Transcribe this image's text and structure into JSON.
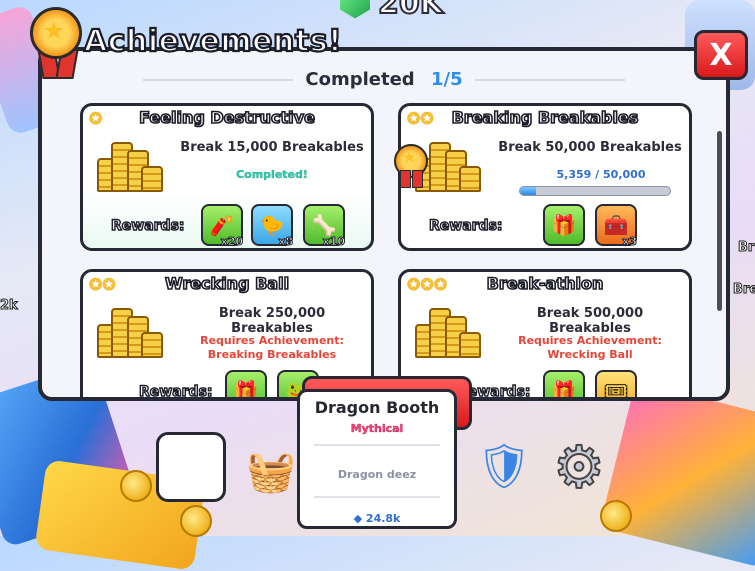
{
  "currency": {
    "value": "20K",
    "icon": "gem-icon"
  },
  "side_labels": {
    "left": "2k",
    "right_top": "Br",
    "right_mid": "Bre"
  },
  "panel": {
    "title": "Achievements!",
    "close_label": "X",
    "completed_label": "Completed",
    "completed_count": "1/5"
  },
  "cards": [
    {
      "title": "Feeling Destructive",
      "task": "Break 15,000 Breakables",
      "status": "Completed!",
      "rewards_label": "Rewards:",
      "rewards": [
        {
          "icon": "firework-icon",
          "qty": "x20"
        },
        {
          "icon": "duck-icon",
          "qty": "x8"
        },
        {
          "icon": "bone-icon",
          "qty": "x10"
        }
      ]
    },
    {
      "title": "Breaking Breakables",
      "task": "Break 50,000 Breakables",
      "progress_current": "5,359",
      "progress_sep": "/",
      "progress_total": "50,000",
      "progress_fraction": 0.107,
      "rewards_label": "Rewards:",
      "rewards": [
        {
          "icon": "gift-bag-icon",
          "qty": ""
        },
        {
          "icon": "chest-icon",
          "qty": "x3"
        }
      ]
    },
    {
      "title": "Wrecking Ball",
      "task": "Break 250,000 Breakables",
      "req_line1": "Requires Achievement:",
      "req_line2": "Breaking Breakables",
      "rewards_label": "Rewards:"
    },
    {
      "title": "Break-athlon",
      "task": "Break 500,000 Breakables",
      "req_line1": "Requires Achievement:",
      "req_line2": "Wrecking Ball",
      "rewards_label": "Rewards:"
    }
  ],
  "tooltip": {
    "title": "Dragon Booth",
    "rarity": "Mythical",
    "description": "Dragon deez",
    "price": "24.8k"
  }
}
